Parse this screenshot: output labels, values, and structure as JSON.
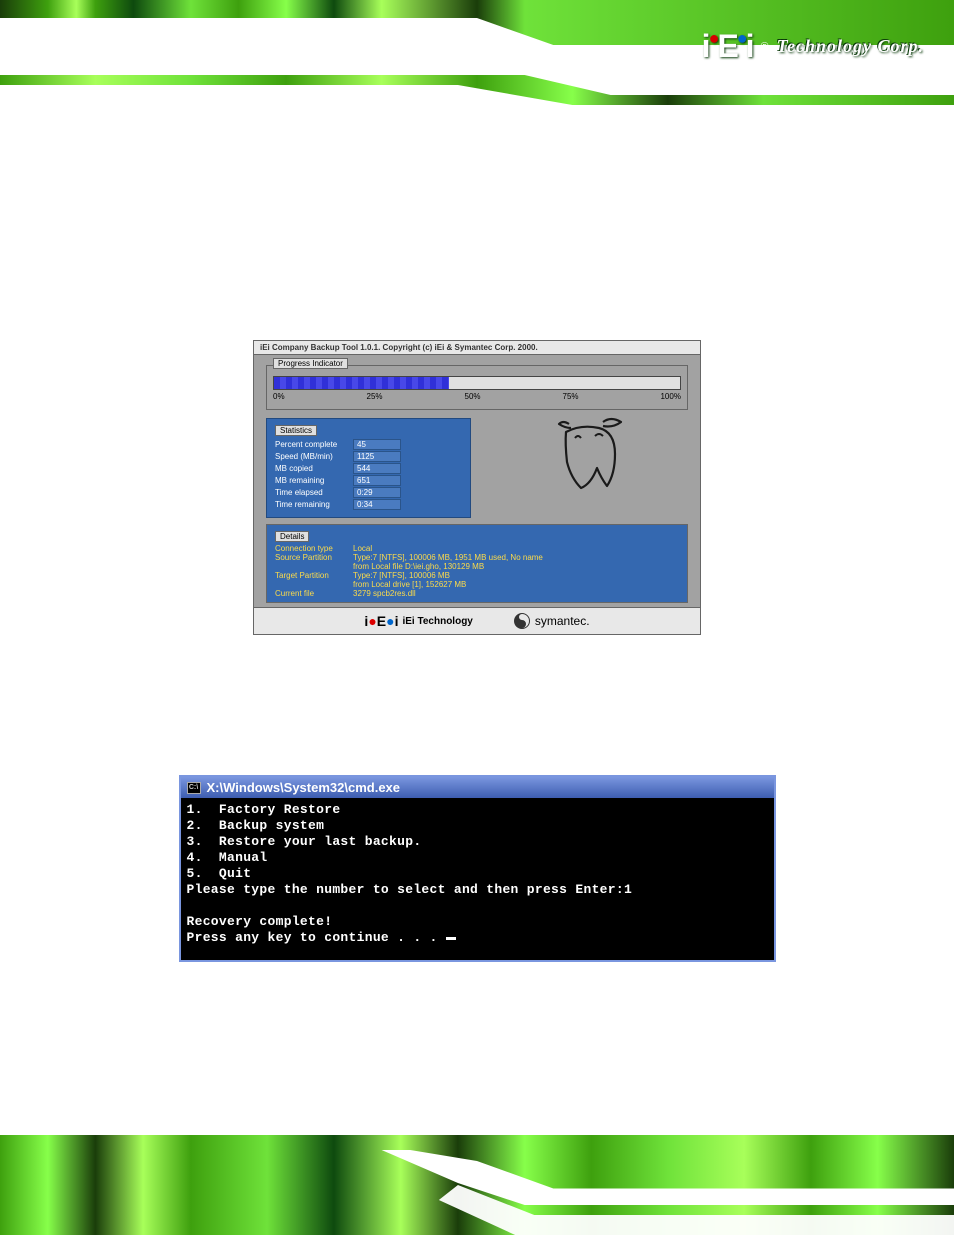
{
  "header": {
    "logo_text": "iEi",
    "logo_reg": "®",
    "company": "Technology Corp."
  },
  "ghost": {
    "titlebar": "iEi Company Backup Tool 1.0.1.   Copyright (c) iEi & Symantec Corp. 2000.",
    "progress_label": "Progress Indicator",
    "ticks": {
      "t0": "0%",
      "t25": "25%",
      "t50": "50%",
      "t75": "75%",
      "t100": "100%"
    },
    "stats_label": "Statistics",
    "stats": {
      "percent_lbl": "Percent complete",
      "percent_val": "45",
      "speed_lbl": "Speed (MB/min)",
      "speed_val": "1125",
      "copied_lbl": "MB copied",
      "copied_val": "544",
      "remain_lbl": "MB remaining",
      "remain_val": "651",
      "elapsed_lbl": "Time elapsed",
      "elapsed_val": "0:29",
      "tremain_lbl": "Time remaining",
      "tremain_val": "0:34"
    },
    "details_label": "Details",
    "details": {
      "conn_lbl": "Connection type",
      "conn_val": "Local",
      "src_lbl": "Source Partition",
      "src_val1": "Type:7 [NTFS], 100006 MB, 1951 MB used, No name",
      "src_val2": "from Local file D:\\iei.gho, 130129 MB",
      "tgt_lbl": "Target Partition",
      "tgt_val1": "Type:7 [NTFS], 100006 MB",
      "tgt_val2": "from Local drive [1], 152627 MB",
      "file_lbl": "Current file",
      "file_val": "3279 spcb2res.dll"
    },
    "footer": {
      "iei": "iEi Technology",
      "symantec": "symantec."
    }
  },
  "cmd": {
    "title": "X:\\Windows\\System32\\cmd.exe",
    "line1": "1.  Factory Restore",
    "line2": "2.  Backup system",
    "line3": "3.  Restore your last backup.",
    "line4": "4.  Manual",
    "line5": "5.  Quit",
    "prompt": "Please type the number to select and then press Enter:1",
    "blank": "",
    "complete": "Recovery complete!",
    "continue": "Press any key to continue . . . "
  }
}
